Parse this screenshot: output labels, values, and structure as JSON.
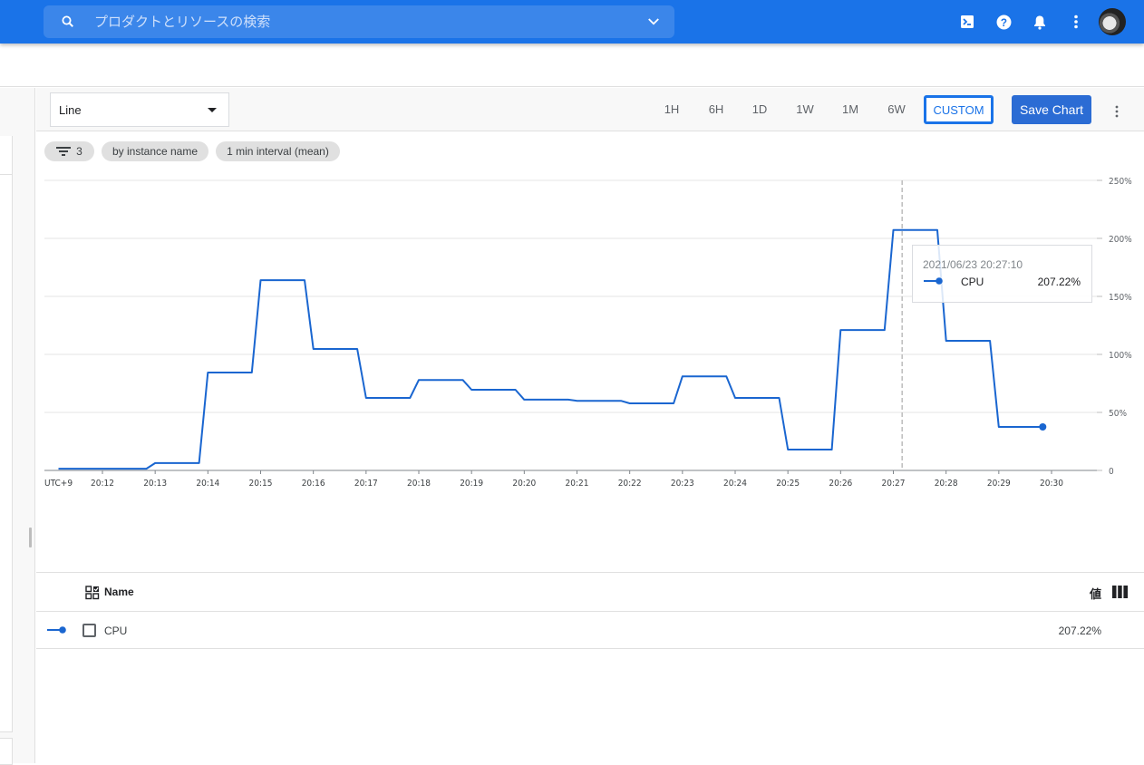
{
  "topbar": {
    "search_placeholder": "プロダクトとリソースの検索",
    "icons": [
      "search-icon",
      "chevron-down-icon",
      "cloud-shell-icon",
      "help-icon",
      "notifications-icon",
      "more-vert-icon",
      "avatar"
    ]
  },
  "toolbar": {
    "chart_type": "Line",
    "ranges": [
      "1H",
      "6H",
      "1D",
      "1W",
      "1M",
      "6W"
    ],
    "custom_label": "CUSTOM",
    "save_label": "Save Chart"
  },
  "chips": {
    "filter_count": "3",
    "group_by": "by instance name",
    "aggregation": "1 min interval (mean)"
  },
  "tooltip": {
    "timestamp": "2021/06/23 20:27:10",
    "series": "CPU",
    "value": "207.22%"
  },
  "legend": {
    "name_header": "Name",
    "value_header": "値",
    "rows": [
      {
        "name": "CPU",
        "value": "207.22%"
      }
    ]
  },
  "colors": {
    "brand": "#1a73e8",
    "series": "#1a66d0",
    "save_button": "#2b6cd4"
  },
  "chart_data": {
    "type": "line",
    "title": "",
    "xlabel": "",
    "ylabel": "",
    "timezone_label": "UTC+9",
    "x_tick_labels": [
      "20:12",
      "20:13",
      "20:14",
      "20:15",
      "20:16",
      "20:17",
      "20:18",
      "20:19",
      "20:20",
      "20:21",
      "20:22",
      "20:23",
      "20:24",
      "20:25",
      "20:26",
      "20:27",
      "20:28",
      "20:29",
      "20:30"
    ],
    "y_tick_labels": [
      "0",
      "50%",
      "100%",
      "150%",
      "200%",
      "250%"
    ],
    "ylim": [
      0,
      250
    ],
    "xlim_minutes": [
      "20:11:10",
      "20:31:00"
    ],
    "grid": true,
    "hover_time": "20:27:10",
    "series": [
      {
        "name": "CPU",
        "unit": "%",
        "x": [
          "20:11:10",
          "20:12:50",
          "20:13:00",
          "20:13:50",
          "20:14:00",
          "20:14:50",
          "20:15:00",
          "20:15:50",
          "20:16:00",
          "20:16:50",
          "20:17:00",
          "20:17:50",
          "20:18:00",
          "20:18:50",
          "20:19:00",
          "20:19:50",
          "20:20:00",
          "20:20:50",
          "20:21:00",
          "20:21:50",
          "20:22:00",
          "20:22:50",
          "20:23:00",
          "20:23:50",
          "20:24:00",
          "20:24:50",
          "20:25:00",
          "20:25:50",
          "20:26:00",
          "20:26:50",
          "20:27:00",
          "20:27:50",
          "20:28:00",
          "20:28:50",
          "20:29:00",
          "20:29:50"
        ],
        "values": [
          1.5,
          1.5,
          6.3,
          6.3,
          84.4,
          84.4,
          164,
          164,
          104.7,
          104.7,
          62.5,
          62.5,
          78,
          78,
          69.5,
          69.5,
          61,
          61,
          60,
          60,
          57.8,
          57.8,
          81,
          81,
          62.5,
          62.5,
          18,
          18,
          121,
          121,
          207.22,
          207.22,
          111.7,
          111.7,
          37.5,
          37.5
        ]
      }
    ]
  }
}
